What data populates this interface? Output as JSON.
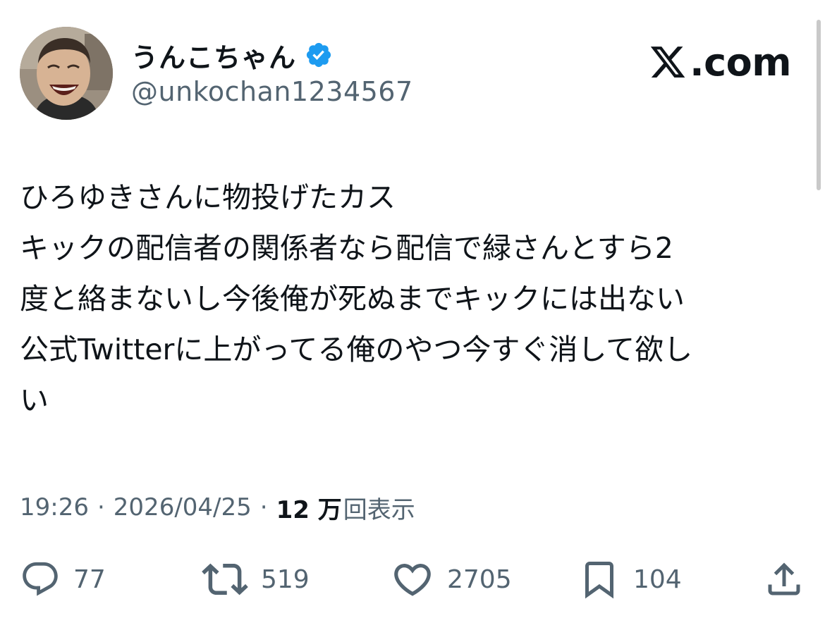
{
  "header": {
    "display_name": "うんこちゃん",
    "handle": "@unkochan1234567",
    "verified": true,
    "verified_icon": "verified-badge-icon",
    "brand_text": ".com",
    "brand_icon": "x-logo-icon"
  },
  "tweet": {
    "lines": [
      "ひろゆきさんに物投げたカス",
      "キックの配信者の関係者なら配信で緑さんとすら2",
      "度と絡まないし今後俺が死ぬまでキックには出ない",
      "公式Twitterに上がってる俺のやつ今すぐ消して欲し",
      "い"
    ]
  },
  "meta": {
    "time": "19:26",
    "separator": "·",
    "date": "2026/04/25",
    "views_count": "12 万",
    "views_label": "回表示"
  },
  "actions": {
    "reply": {
      "icon": "reply-icon",
      "count": "77"
    },
    "retweet": {
      "icon": "retweet-icon",
      "count": "519"
    },
    "like": {
      "icon": "heart-icon",
      "count": "2705"
    },
    "bookmark": {
      "icon": "bookmark-icon",
      "count": "104"
    },
    "share": {
      "icon": "share-icon"
    }
  },
  "colors": {
    "text": "#0f1419",
    "secondary": "#536471",
    "verified": "#1d9bf0"
  }
}
